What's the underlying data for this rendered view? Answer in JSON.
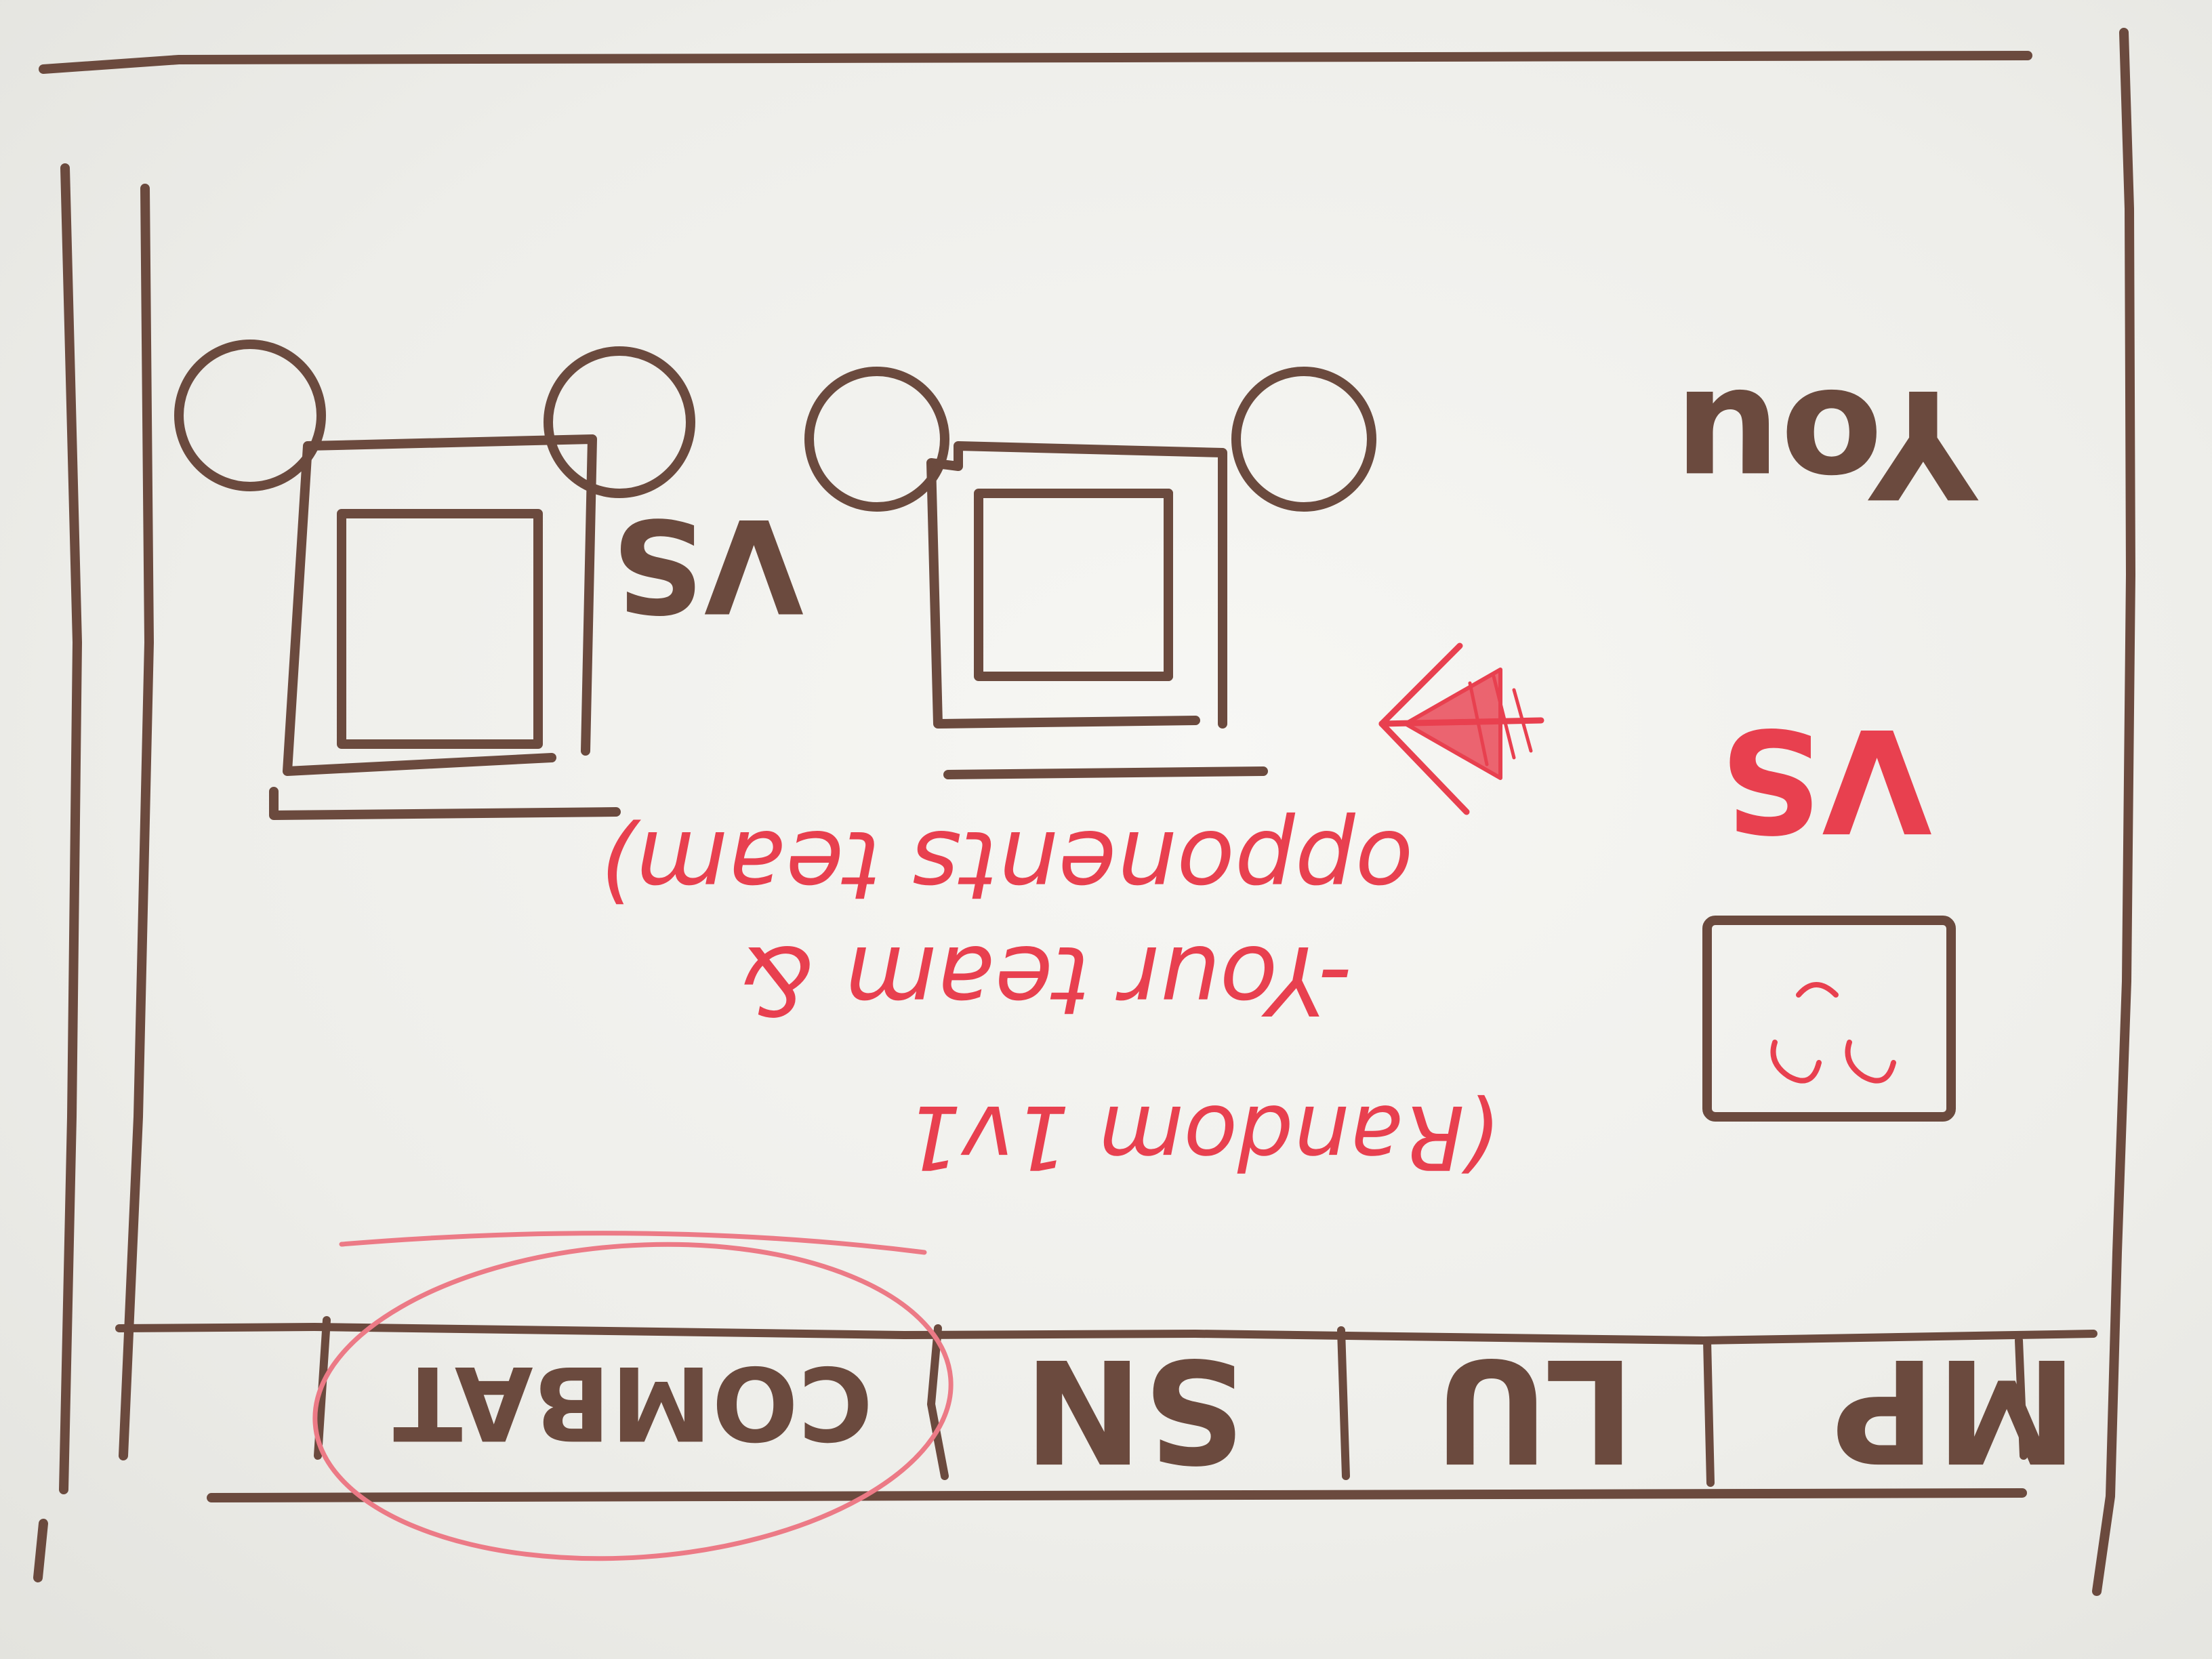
{
  "labels": {
    "you": "You",
    "vs_main": "VS",
    "vs_teams": "VS",
    "note_line1": "(Random 1v1",
    "note_line1_blue": "1v1",
    "note_line2": "-Your team &",
    "note_line3": "opponents team)"
  },
  "tabs": [
    {
      "label": "MP",
      "selected": false
    },
    {
      "label": "LU",
      "selected": false
    },
    {
      "label": "SN",
      "selected": false
    },
    {
      "label": "COMBAT",
      "selected": true
    }
  ],
  "colors": {
    "brown_ink": "#6b4a3e",
    "red_ink": "#e8404f",
    "blue_ink": "#2a47b8",
    "highlight_circle": "#ec7a86"
  }
}
